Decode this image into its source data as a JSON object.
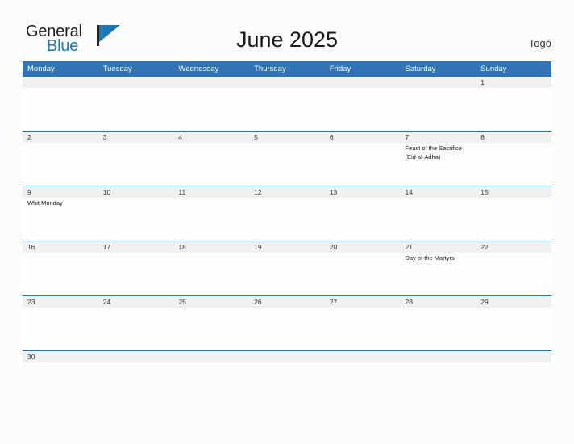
{
  "brand": {
    "name_part1": "General",
    "name_part2": "Blue",
    "mark_icon": "flag-triangle-icon"
  },
  "header": {
    "title": "June 2025",
    "country": "Togo"
  },
  "calendar": {
    "day_headers": [
      "Monday",
      "Tuesday",
      "Wednesday",
      "Thursday",
      "Friday",
      "Saturday",
      "Sunday"
    ],
    "accent_color": "#3173b5",
    "date_band_color": "#f0f0f0",
    "weeks": [
      {
        "dates": [
          "",
          "",
          "",
          "",
          "",
          "",
          "1"
        ],
        "events": [
          "",
          "",
          "",
          "",
          "",
          "",
          ""
        ]
      },
      {
        "dates": [
          "2",
          "3",
          "4",
          "5",
          "6",
          "7",
          "8"
        ],
        "events": [
          "",
          "",
          "",
          "",
          "",
          "Feast of the Sacrifice (Eid al-Adha)",
          ""
        ]
      },
      {
        "dates": [
          "9",
          "10",
          "11",
          "12",
          "13",
          "14",
          "15"
        ],
        "events": [
          "Whit Monday",
          "",
          "",
          "",
          "",
          "",
          ""
        ]
      },
      {
        "dates": [
          "16",
          "17",
          "18",
          "19",
          "20",
          "21",
          "22"
        ],
        "events": [
          "",
          "",
          "",
          "",
          "",
          "Day of the Martyrs",
          ""
        ]
      },
      {
        "dates": [
          "23",
          "24",
          "25",
          "26",
          "27",
          "28",
          "29"
        ],
        "events": [
          "",
          "",
          "",
          "",
          "",
          "",
          ""
        ]
      },
      {
        "dates": [
          "30",
          "",
          "",
          "",
          "",
          "",
          ""
        ],
        "events": [
          "",
          "",
          "",
          "",
          "",
          "",
          ""
        ]
      }
    ]
  }
}
